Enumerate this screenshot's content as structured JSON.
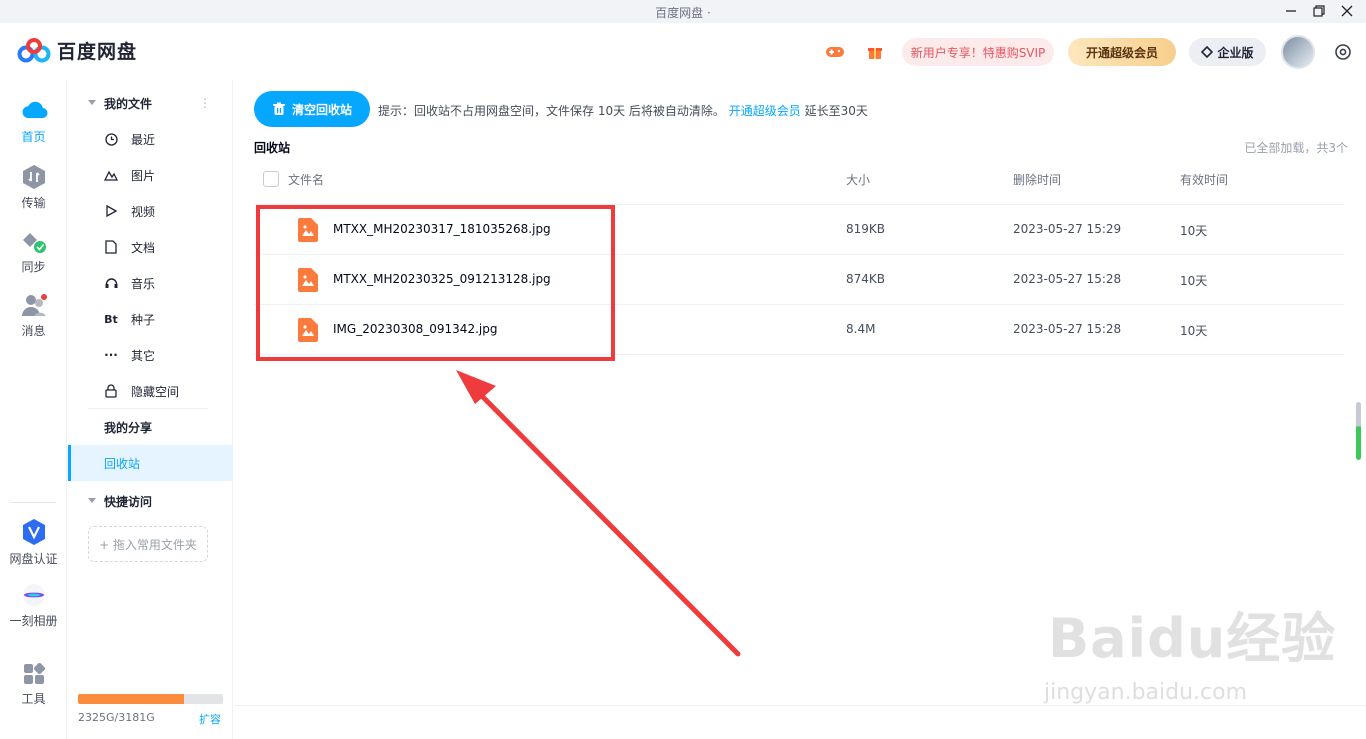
{
  "window": {
    "title": "百度网盘 ·"
  },
  "app": {
    "name": "百度网盘"
  },
  "header": {
    "new_user_offer": "新用户专享！特惠购SVIP",
    "vip_button": "开通超级会员",
    "enterprise_button": "企业版"
  },
  "rail": {
    "items": [
      {
        "label": "首页",
        "icon": "cloud-icon"
      },
      {
        "label": "传输",
        "icon": "transfer-icon"
      },
      {
        "label": "同步",
        "icon": "sync-icon"
      },
      {
        "label": "消息",
        "icon": "message-icon"
      },
      {
        "label": "网盘认证",
        "icon": "verify-icon"
      },
      {
        "label": "一刻相册",
        "icon": "album-icon"
      },
      {
        "label": "工具",
        "icon": "tools-icon"
      }
    ]
  },
  "sidebar": {
    "my_files": "我的文件",
    "items": [
      {
        "label": "最近",
        "icon": "clock-icon"
      },
      {
        "label": "图片",
        "icon": "image-icon"
      },
      {
        "label": "视频",
        "icon": "play-icon"
      },
      {
        "label": "文档",
        "icon": "document-icon"
      },
      {
        "label": "音乐",
        "icon": "headphones-icon"
      },
      {
        "label": "种子",
        "icon": "bt-icon"
      },
      {
        "label": "其它",
        "icon": "more-icon"
      },
      {
        "label": "隐藏空间",
        "icon": "lock-icon"
      }
    ],
    "my_share": "我的分享",
    "recycle_bin": "回收站",
    "quick_access": "快捷访问",
    "drop_zone": "+ 拖入常用文件夹",
    "quota_text": "2325G/3181G",
    "quota_fraction": 0.731,
    "expand_link": "扩容"
  },
  "toolbar": {
    "empty_button": "清空回收站",
    "tip_prefix": "提示：回收站不占用网盘空间，文件保存 10天 后将被自动清除。",
    "tip_link": "开通超级会员",
    "tip_suffix": " 延长至30天"
  },
  "list": {
    "title": "回收站",
    "loaded_status": "已全部加载，共3个",
    "columns": {
      "name": "文件名",
      "size": "大小",
      "deleted": "删除时间",
      "valid": "有效时间"
    },
    "rows": [
      {
        "name": "MTXX_MH20230317_181035268.jpg",
        "size": "819KB",
        "deleted": "2023-05-27 15:29",
        "valid": "10天"
      },
      {
        "name": "MTXX_MH20230325_091213128.jpg",
        "size": "874KB",
        "deleted": "2023-05-27 15:28",
        "valid": "10天"
      },
      {
        "name": "IMG_20230308_091342.jpg",
        "size": "8.4M",
        "deleted": "2023-05-27 15:28",
        "valid": "10天"
      }
    ]
  },
  "watermark": {
    "brand": "Baidu经验",
    "url": "jingyan.baidu.com"
  },
  "colors": {
    "accent": "#06a7ff",
    "annotation": "#ef3b3b",
    "file_icon": "#fb7a3c",
    "quota": "#fb8c3d"
  }
}
